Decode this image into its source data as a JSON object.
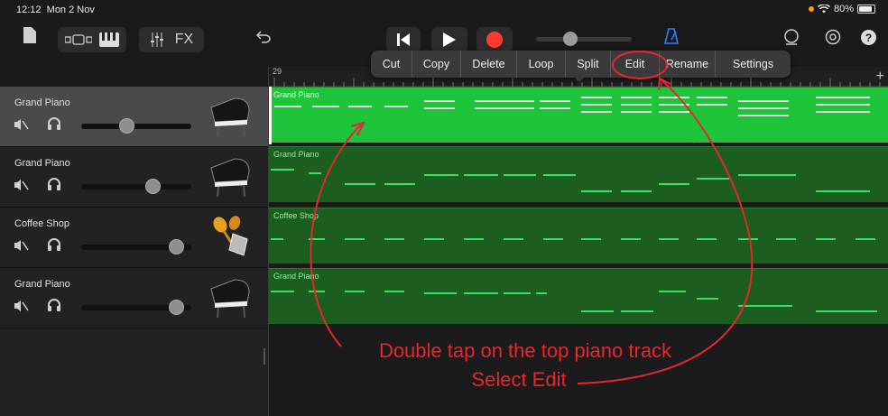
{
  "status": {
    "time": "12:12",
    "date": "Mon 2 Nov",
    "battery": "80%"
  },
  "toolbar": {
    "fx_label": "FX",
    "help_label": "?",
    "accent": "#e8262d"
  },
  "menu": {
    "items": [
      "Cut",
      "Copy",
      "Delete",
      "Loop",
      "Split",
      "Edit",
      "Rename",
      "Settings"
    ]
  },
  "ruler": {
    "bar": "29"
  },
  "tracks": [
    {
      "name": "Grand Piano",
      "region": "Grand Piano",
      "volume": 0.4,
      "icon": "grand-piano",
      "selected": true
    },
    {
      "name": "Grand Piano",
      "region": "Grand Piano",
      "volume": 0.68,
      "icon": "grand-piano",
      "selected": false
    },
    {
      "name": "Coffee Shop",
      "region": "Coffee Shop",
      "volume": 0.92,
      "icon": "maracas-cowbell",
      "selected": false
    },
    {
      "name": "Grand Piano",
      "region": "Grand Piano",
      "volume": 0.92,
      "icon": "grand-piano",
      "selected": false
    }
  ],
  "annotation": {
    "line1": "Double tap on the top piano track",
    "line2": "Select Edit"
  },
  "colors": {
    "region_selected": "#1ec43a",
    "region": "#1b5e20",
    "record": "#ff3b30",
    "annotation": "#e8262d",
    "metronome": "#2f7bff"
  }
}
